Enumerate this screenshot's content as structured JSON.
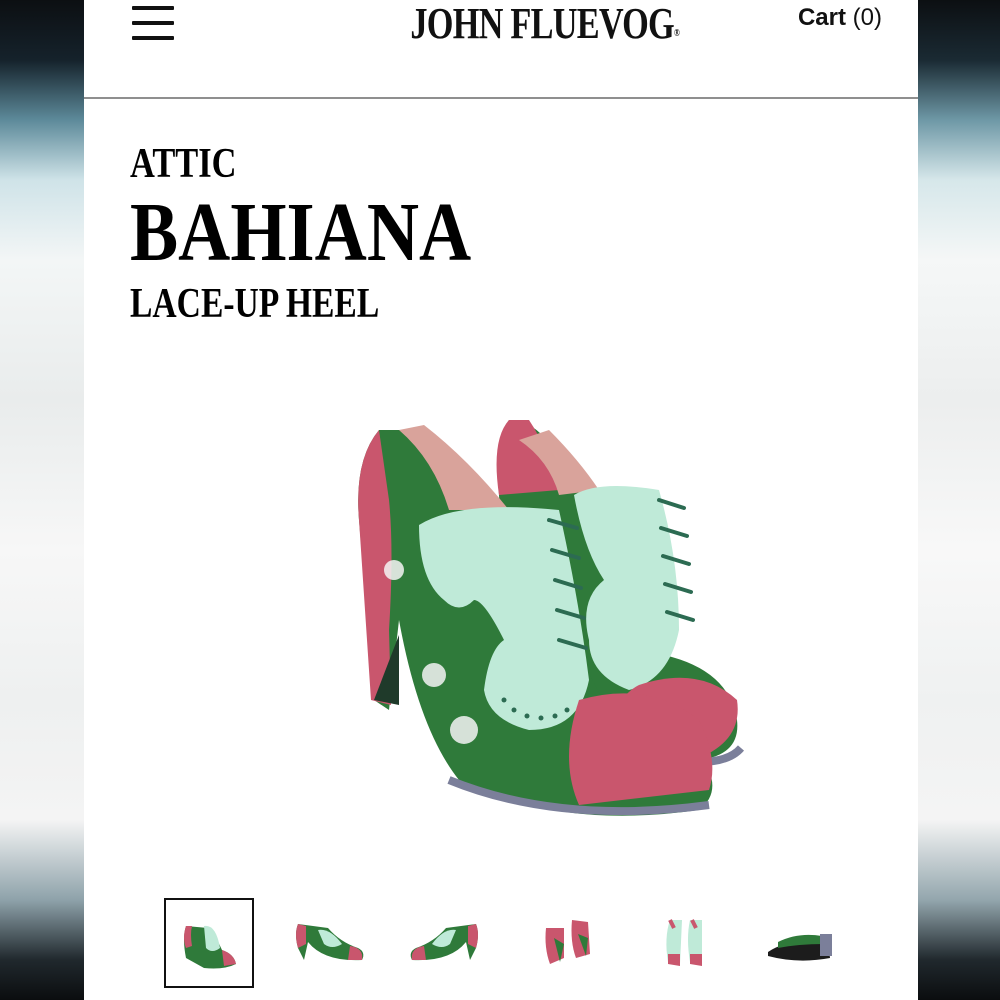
{
  "header": {
    "logo_text": "JOHN FLUEVOG",
    "logo_mark": "®",
    "cart_label": "Cart",
    "cart_count": "(0)"
  },
  "product": {
    "collection": "ATTIC",
    "name": "BAHIANA",
    "type": "LACE-UP HEEL"
  },
  "gallery": {
    "selected_index": 0,
    "thumbnail_count": 6
  },
  "colors": {
    "toe_cap": "#c9566d",
    "mint": "#bfead8",
    "floral_green": "#2f7a3a",
    "sole": "#7b7f9a"
  }
}
